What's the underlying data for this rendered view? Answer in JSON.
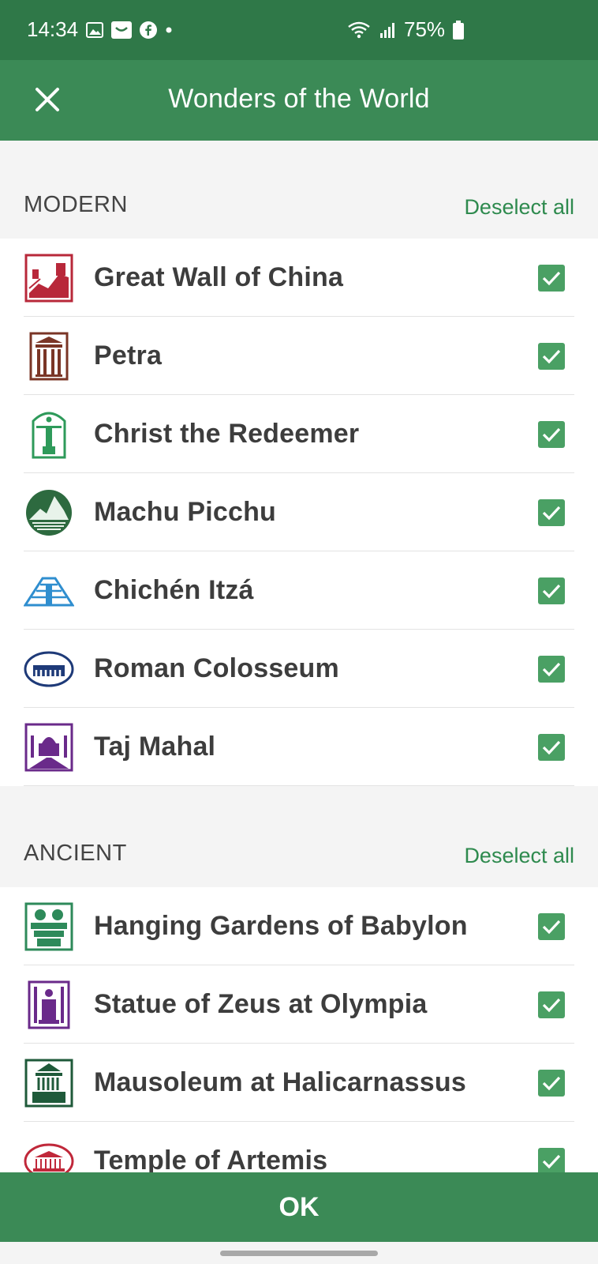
{
  "status_bar": {
    "time": "14:34",
    "battery": "75%",
    "icons_left": [
      "gallery-icon",
      "mail-icon",
      "facebook-icon",
      "dot-icon"
    ],
    "icons_right": [
      "wifi-icon",
      "signal-icon",
      "battery-icon"
    ]
  },
  "app_bar": {
    "title": "Wonders of the World",
    "close_icon": "close-icon"
  },
  "sections": [
    {
      "title": "MODERN",
      "action": "Deselect all",
      "items": [
        {
          "label": "Great Wall of China",
          "icon": "great-wall-icon",
          "color": "#b8283a",
          "checked": true
        },
        {
          "label": "Petra",
          "icon": "petra-icon",
          "color": "#7a3526",
          "checked": true
        },
        {
          "label": "Christ the Redeemer",
          "icon": "christ-redeemer-icon",
          "color": "#2e9a5a",
          "checked": true
        },
        {
          "label": "Machu Picchu",
          "icon": "machu-picchu-icon",
          "color": "#2d6a3f",
          "checked": true
        },
        {
          "label": "Chichén Itzá",
          "icon": "chichen-itza-icon",
          "color": "#2f8ecf",
          "checked": true
        },
        {
          "label": "Roman Colosseum",
          "icon": "colosseum-icon",
          "color": "#1e3a78",
          "checked": true
        },
        {
          "label": "Taj Mahal",
          "icon": "taj-mahal-icon",
          "color": "#6a2a8a",
          "checked": true
        }
      ]
    },
    {
      "title": "ANCIENT",
      "action": "Deselect all",
      "items": [
        {
          "label": "Hanging Gardens of Babylon",
          "icon": "hanging-gardens-icon",
          "color": "#2e8a5a",
          "checked": true
        },
        {
          "label": "Statue of Zeus at Olympia",
          "icon": "statue-zeus-icon",
          "color": "#6a2a8a",
          "checked": true
        },
        {
          "label": "Mausoleum at Halicarnassus",
          "icon": "mausoleum-icon",
          "color": "#1f5a3a",
          "checked": true
        },
        {
          "label": "Temple of Artemis",
          "icon": "temple-artemis-icon",
          "color": "#c0283a",
          "checked": true
        }
      ]
    }
  ],
  "footer": {
    "ok_label": "OK"
  },
  "colors": {
    "status_bar": "#2f7848",
    "app_bar": "#3b8a56",
    "checkbox": "#4aa064",
    "link": "#2e8a4e"
  }
}
